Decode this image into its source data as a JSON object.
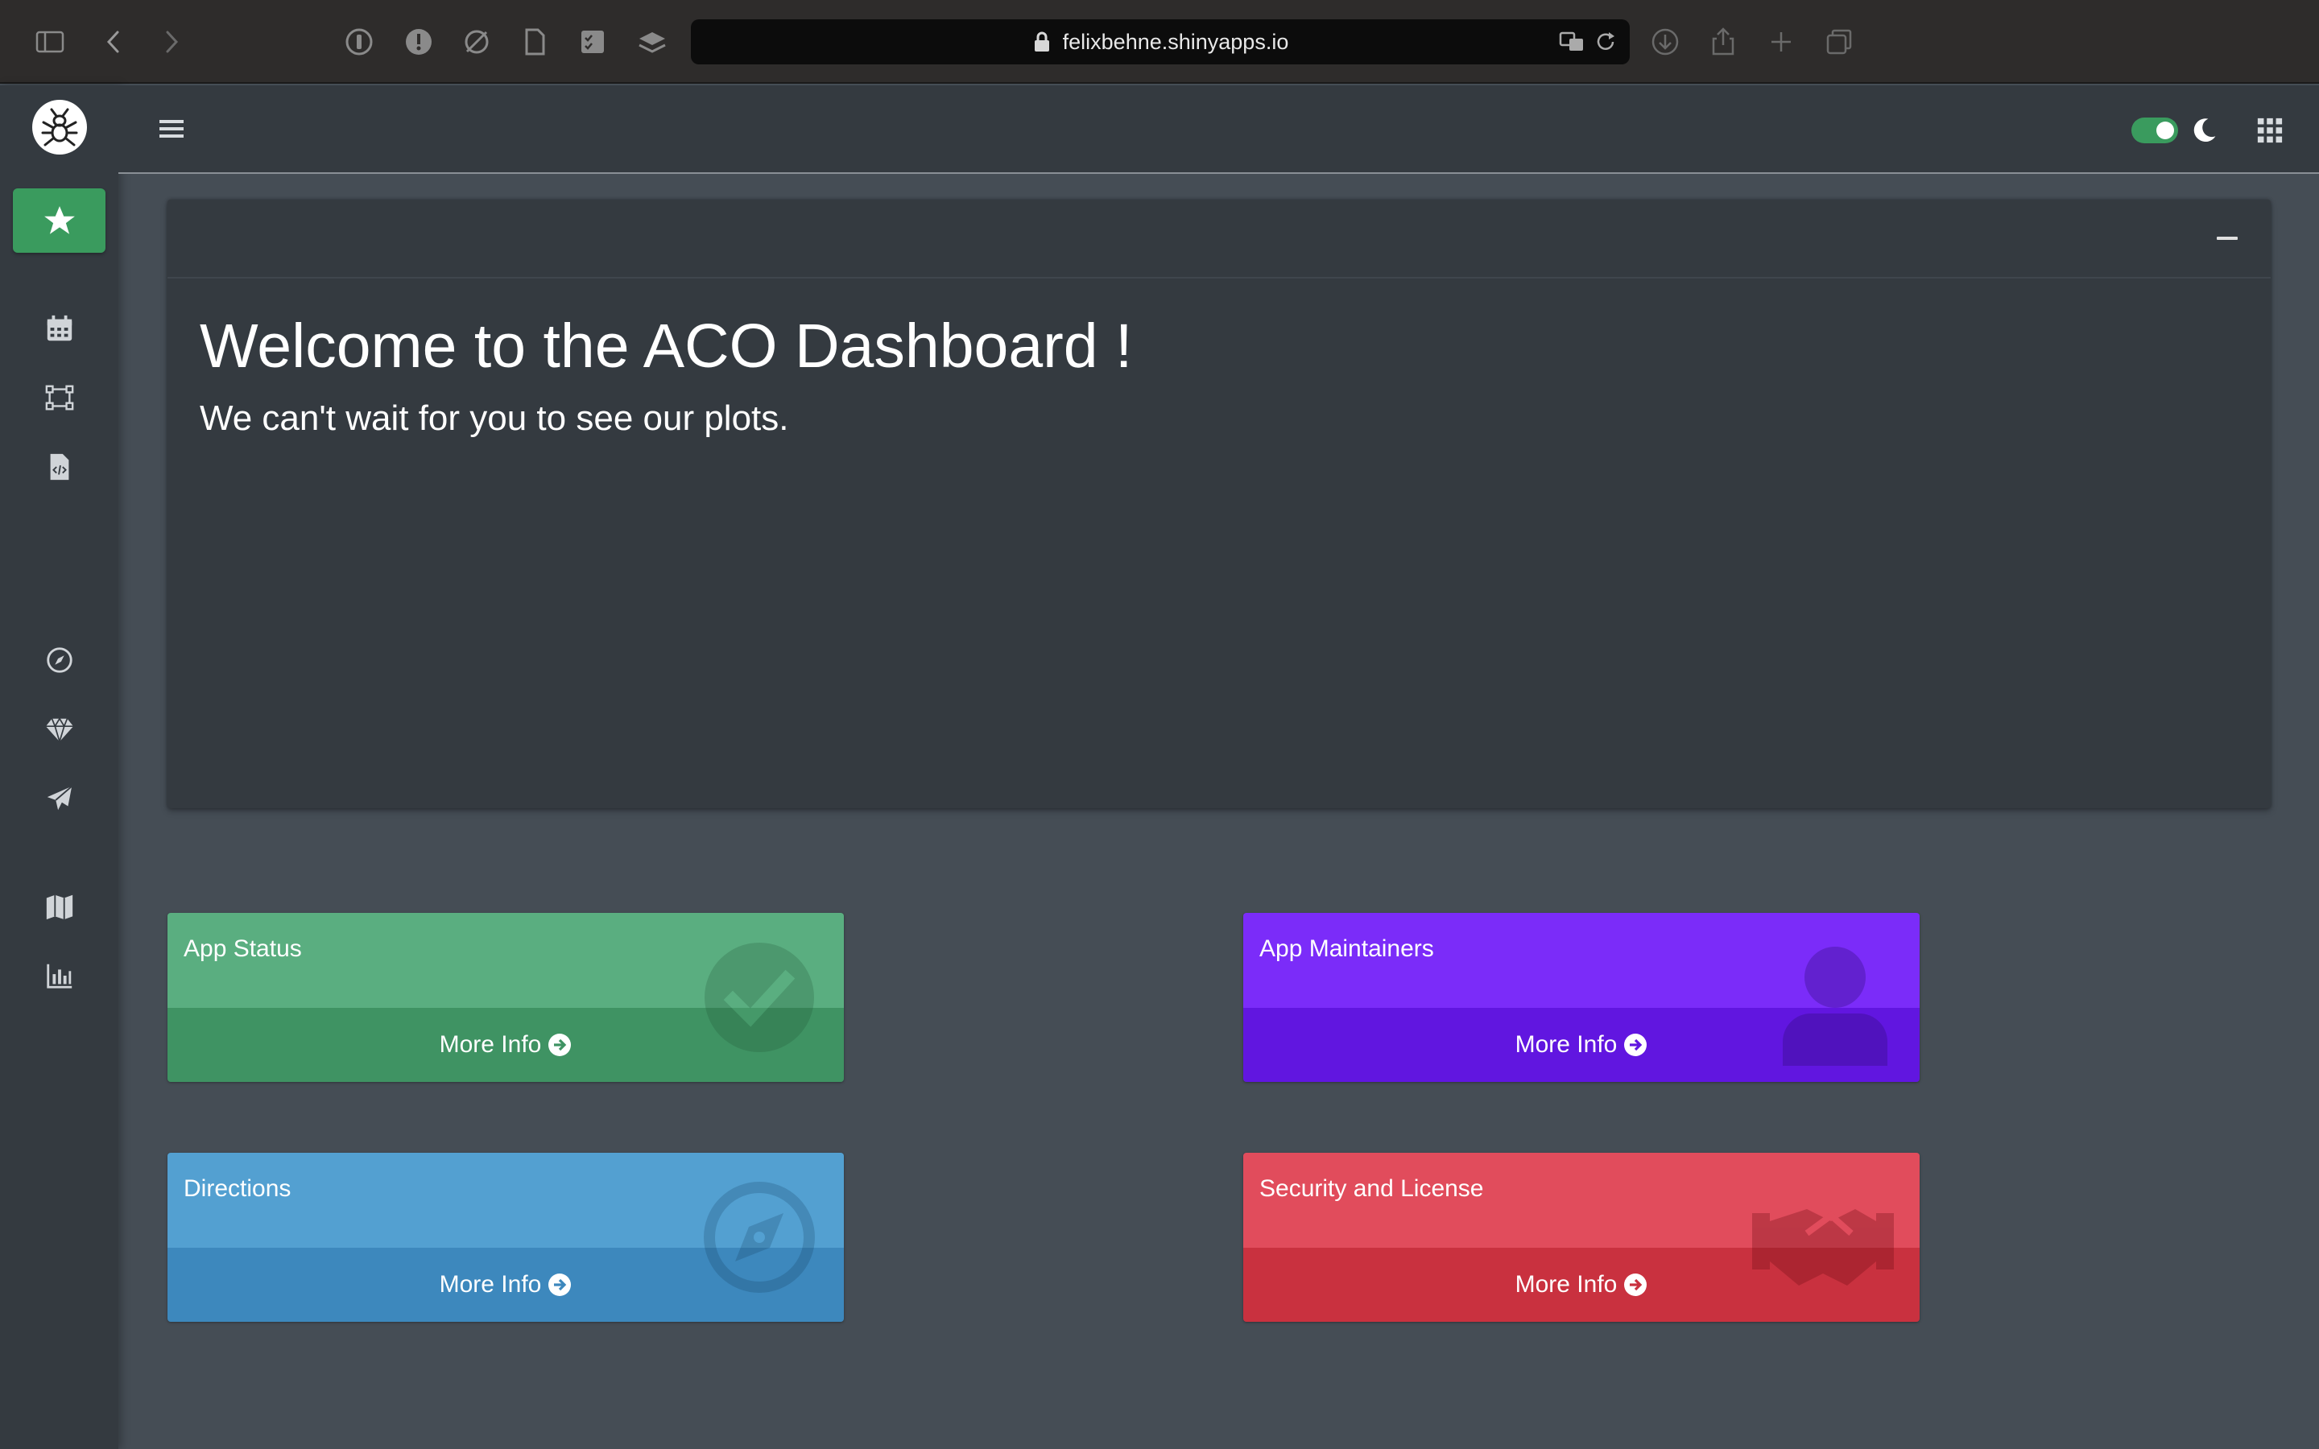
{
  "browser": {
    "url": "felixbehne.shinyapps.io"
  },
  "navbar": {
    "dark_mode_enabled": true
  },
  "welcome": {
    "title": "Welcome to the ACO Dashboard !",
    "subtitle": "We can't wait for you to see our plots."
  },
  "info_boxes": [
    {
      "title": "App Status",
      "link": "More Info",
      "icon": "check-circle-icon",
      "color": "#5aae80"
    },
    {
      "title": "App Maintainers",
      "link": "More Info",
      "icon": "user-icon",
      "color": "#7b2cf9"
    },
    {
      "title": "Directions",
      "link": "More Info",
      "icon": "compass-icon",
      "color": "#53a0d1"
    },
    {
      "title": "Security and License",
      "link": "More Info",
      "icon": "handshake-icon",
      "color": "#e14c5c"
    }
  ],
  "colors": {
    "accent": "#3a9b5e",
    "sidebar": "#343a40",
    "background": "#454d55"
  }
}
